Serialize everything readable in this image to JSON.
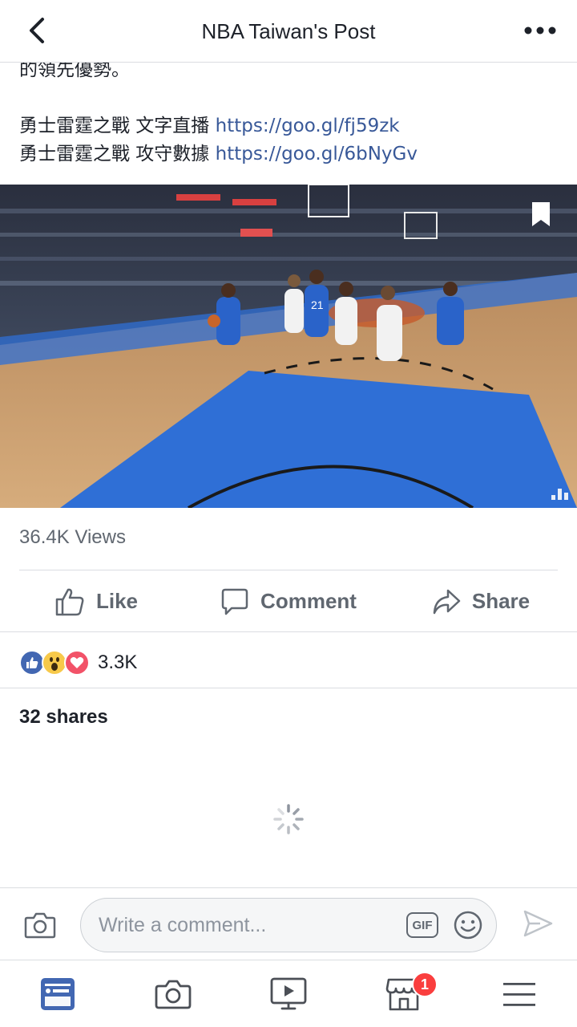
{
  "header": {
    "title": "NBA Taiwan's Post"
  },
  "post": {
    "text_tail": "的領先優勢。",
    "lines": [
      {
        "prefix": "勇士雷霆之戰 文字直播 ",
        "link": "https://goo.gl/fj59zk"
      },
      {
        "prefix": "勇士雷霆之戰 攻守數據 ",
        "link": "https://goo.gl/6bNyGv"
      }
    ]
  },
  "video": {
    "jersey_number": "21"
  },
  "stats": {
    "views": "36.4K Views",
    "reactions_count": "3.3K",
    "shares": "32 shares"
  },
  "actions": {
    "like": "Like",
    "comment": "Comment",
    "share": "Share"
  },
  "comment_bar": {
    "placeholder": "Write a comment...",
    "gif_label": "GIF"
  },
  "tabbar": {
    "marketplace_badge": "1"
  },
  "colors": {
    "link": "#385898",
    "fb_blue": "#4267b2",
    "badge": "#fa3e3e",
    "court_blue": "#2f6fd6"
  }
}
